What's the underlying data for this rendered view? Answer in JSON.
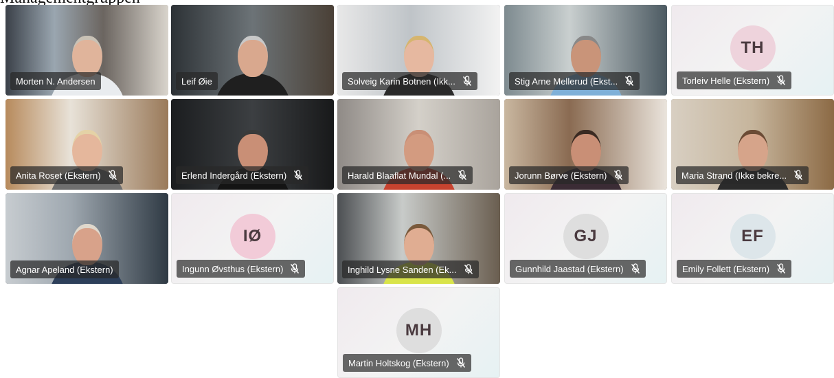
{
  "caption": "Managementgruppen",
  "participants": [
    {
      "name": "Morten N. Andersen",
      "muted": false,
      "video": true
    },
    {
      "name": "Leif Øie",
      "muted": false,
      "video": true
    },
    {
      "name": "Solveig Karin Botnen (Ikk...",
      "muted": true,
      "video": true
    },
    {
      "name": "Stig Arne Mellerud (Ekst...",
      "muted": true,
      "video": true
    },
    {
      "name": "Torleiv Helle (Ekstern)",
      "muted": true,
      "video": false,
      "initials": "TH"
    },
    {
      "name": "Anita Roset (Ekstern)",
      "muted": true,
      "video": true
    },
    {
      "name": "Erlend Indergård (Ekstern)",
      "muted": true,
      "video": true
    },
    {
      "name": "Harald Blaaflat Mundal (...",
      "muted": true,
      "video": true
    },
    {
      "name": "Jorunn Børve (Ekstern)",
      "muted": true,
      "video": true
    },
    {
      "name": "Maria Strand (Ikke bekre...",
      "muted": true,
      "video": true
    },
    {
      "name": "Agnar Apeland (Ekstern)",
      "muted": false,
      "video": true
    },
    {
      "name": "Ingunn Øvsthus (Ekstern)",
      "muted": true,
      "video": false,
      "initials": "IØ"
    },
    {
      "name": "Inghild Lysne Sanden (Ek...",
      "muted": true,
      "video": true
    },
    {
      "name": "Gunnhild Jaastad (Ekstern)",
      "muted": true,
      "video": false,
      "initials": "GJ"
    },
    {
      "name": "Emily Follett (Ekstern)",
      "muted": true,
      "video": false,
      "initials": "EF"
    },
    {
      "name": "Martin Holtskog (Ekstern)",
      "muted": true,
      "video": false,
      "initials": "MH"
    }
  ],
  "colors": {
    "avatar_pink": "#eed3dc",
    "avatar_gray": "#dedede",
    "nameplate_bg": "#3a3a3a"
  },
  "icons": {
    "mic_off": "mic-off-icon"
  }
}
